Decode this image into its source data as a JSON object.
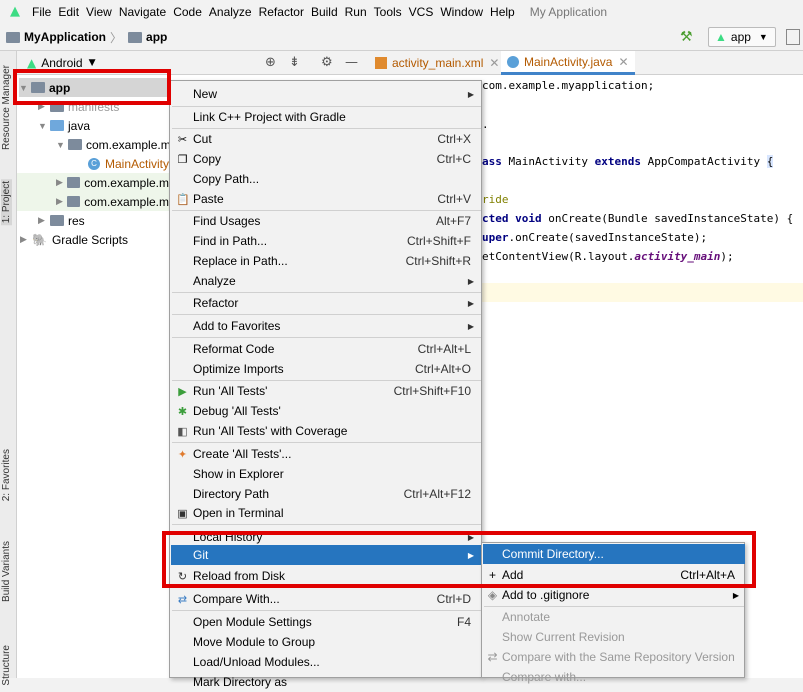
{
  "menubar": {
    "items": [
      "File",
      "Edit",
      "View",
      "Navigate",
      "Code",
      "Analyze",
      "Refactor",
      "Build",
      "Run",
      "Tools",
      "VCS",
      "Window",
      "Help"
    ],
    "app_title": "My Application"
  },
  "navbar": {
    "project": "MyApplication",
    "module": "app",
    "run_config": "app"
  },
  "side_tools": {
    "resource_manager": "Resource Manager",
    "project": "1: Project",
    "favorites": "2: Favorites",
    "build_variants": "Build Variants",
    "structure": "Structure"
  },
  "project_panel": {
    "view_mode": "Android",
    "tree": {
      "app": "app",
      "manifests": "manifests",
      "java": "java",
      "pkg1": "com.example.m",
      "main_activity": "MainActivity",
      "pkg2": "com.example.m",
      "pkg3": "com.example.m",
      "res": "res",
      "gradle": "Gradle Scripts"
    }
  },
  "editor": {
    "tabs": [
      "activity_main.xml",
      "MainActivity.java"
    ],
    "lines": [
      "com.example.myapplication;",
      ".",
      "ass MainActivity extends AppCompatActivity {",
      "ride",
      "cted void onCreate(Bundle savedInstanceState) {",
      "uper.onCreate(savedInstanceState);",
      "etContentView(R.layout.activity_main);"
    ]
  },
  "context_menu": {
    "new": "New",
    "link_cpp": "Link C++ Project with Gradle",
    "cut": "Cut",
    "cut_sc": "Ctrl+X",
    "copy": "Copy",
    "copy_sc": "Ctrl+C",
    "copy_path": "Copy Path...",
    "paste": "Paste",
    "paste_sc": "Ctrl+V",
    "find_usages": "Find Usages",
    "find_usages_sc": "Alt+F7",
    "find_in_path": "Find in Path...",
    "find_in_path_sc": "Ctrl+Shift+F",
    "replace_in_path": "Replace in Path...",
    "replace_in_path_sc": "Ctrl+Shift+R",
    "analyze": "Analyze",
    "refactor": "Refactor",
    "add_favorites": "Add to Favorites",
    "reformat": "Reformat Code",
    "reformat_sc": "Ctrl+Alt+L",
    "optimize": "Optimize Imports",
    "optimize_sc": "Ctrl+Alt+O",
    "run_tests": "Run 'All Tests'",
    "run_tests_sc": "Ctrl+Shift+F10",
    "debug_tests": "Debug 'All Tests'",
    "coverage_tests": "Run 'All Tests' with Coverage",
    "create_tests": "Create 'All Tests'...",
    "show_explorer": "Show in Explorer",
    "dir_path": "Directory Path",
    "dir_path_sc": "Ctrl+Alt+F12",
    "open_terminal": "Open in Terminal",
    "local_history": "Local History",
    "git": "Git",
    "reload_disk": "Reload from Disk",
    "compare_with": "Compare With...",
    "compare_with_sc": "Ctrl+D",
    "module_settings": "Open Module Settings",
    "module_settings_sc": "F4",
    "move_module": "Move Module to Group",
    "load_unload": "Load/Unload Modules...",
    "mark_dir": "Mark Directory as"
  },
  "git_submenu": {
    "commit_dir": "Commit Directory...",
    "add": "Add",
    "add_sc": "Ctrl+Alt+A",
    "gitignore": "Add to .gitignore",
    "annotate": "Annotate",
    "show_revision": "Show Current Revision",
    "compare_repo": "Compare with the Same Repository Version",
    "compare_with": "Compare with..."
  },
  "colors": {
    "selection": "#2675bf",
    "highlight_red": "#e00000",
    "android_green": "#3ddc84"
  }
}
